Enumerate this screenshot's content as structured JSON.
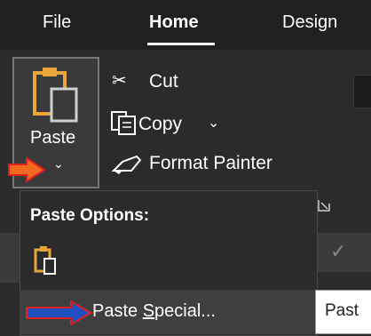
{
  "tabs": {
    "file": "File",
    "home": "Home",
    "design": "Design"
  },
  "clipboard": {
    "paste_label": "Paste",
    "paste_chevron": "⌄",
    "cut_label": "Cut",
    "copy_label": "Copy",
    "copy_chevron": "⌄",
    "format_painter_label": "Format Painter"
  },
  "paste_menu": {
    "header": "Paste Options:",
    "special_prefix": "Paste ",
    "special_accel": "S",
    "special_suffix": "pecial...",
    "tooltip": "Past"
  },
  "colors": {
    "arrow_orange": "#f26a21",
    "arrow_blue": "#1f4fc0",
    "arrow_red": "#e02020",
    "clipboard_gold": "#e9a53a"
  },
  "background": {
    "checkmark": "✓"
  }
}
